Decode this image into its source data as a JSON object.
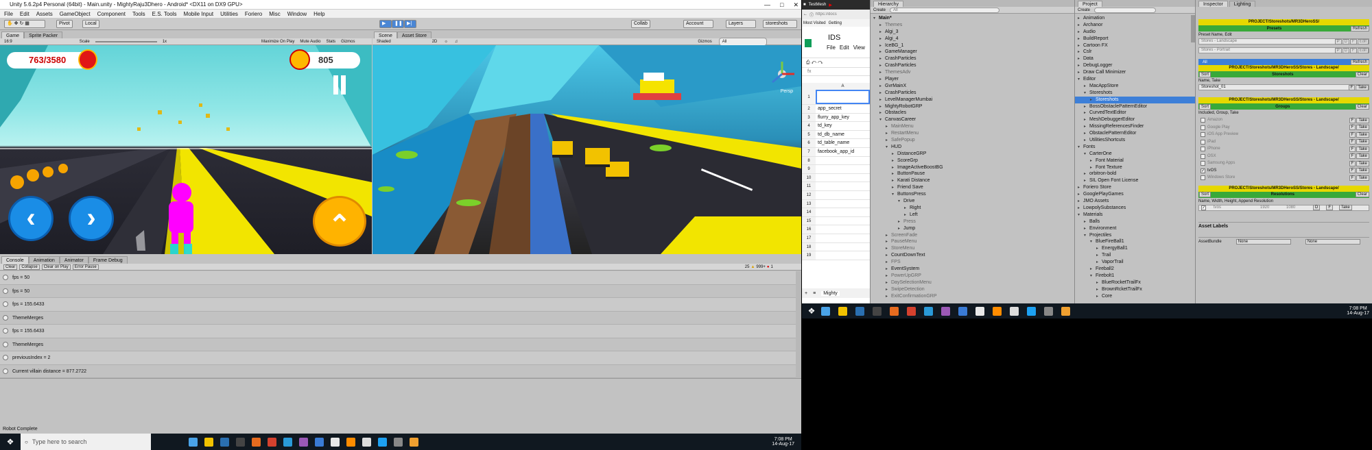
{
  "unity": {
    "title": "Unity 5.6.2p4 Personal (64bit) - Main.unity - MightyRaju3Dhero - Android* <DX11 on DX9 GPU>",
    "menu": [
      "File",
      "Edit",
      "Assets",
      "GameObject",
      "Component",
      "Tools",
      "E.S. Tools",
      "Mobile Input",
      "Utilities",
      "Foriero",
      "Misc",
      "Window",
      "Help"
    ],
    "toolbar": {
      "pivot": "Pivot",
      "local": "Local",
      "collab": "Collab",
      "account": "Account",
      "layers": "Layers",
      "layout": "storeshots"
    },
    "game_tabs": [
      "Game",
      "Sprite Packer"
    ],
    "game_bar": {
      "aspect": "16:9",
      "scale_label": "Scale",
      "scale_value": "1x",
      "maximize": "Maximize On Play",
      "mute": "Mute Audio",
      "stats": "Stats",
      "gizmos": "Gizmos"
    },
    "scene_tabs": [
      "Scene",
      "Asset Store"
    ],
    "scene_bar": {
      "shading": "Shaded",
      "mode": "2D",
      "gizmos": "Gizmos",
      "search": "All"
    },
    "hud": {
      "coins": "763/3580",
      "score": "805",
      "persp": "Persp"
    },
    "console_tabs": [
      "Console",
      "Animation",
      "Animator",
      "Frame Debug"
    ],
    "console_bar": {
      "clear": "Clear",
      "collapse": "Collapse",
      "clear_on_play": "Clear on Play",
      "error_pause": "Error Pause",
      "count_log": "25",
      "count_warn": "999+",
      "count_err": "1"
    },
    "logs": [
      "fps = 50",
      "fps = 50",
      "fps = 155.6433",
      "ThemeMerges",
      "fps = 155.6433",
      "ThemeMerges",
      "previousIndex = 2",
      "Current villain distance = 877.2722"
    ],
    "status": "Robot Complete"
  },
  "taskbar_left": {
    "search": "Type here to search",
    "time": "7:08 PM",
    "date": "14-Aug-17"
  },
  "taskbar_right": {
    "time": "7:08 PM",
    "date": "14-Aug-17"
  },
  "browser": {
    "tab1": "TestMesh",
    "url": "https://docs",
    "bookmark1": "Most Visited",
    "bookmark2": "Getting",
    "sheet_title": "IDS",
    "menu": [
      "File",
      "Edit",
      "View"
    ],
    "col": "A",
    "rows": [
      "1",
      "2",
      "3",
      "4",
      "5",
      "6",
      "7",
      "8",
      "9",
      "10",
      "11",
      "12",
      "13",
      "14",
      "15",
      "16",
      "17",
      "18",
      "19"
    ],
    "cells": [
      "",
      "app_secret",
      "flurry_app_key",
      "td_key",
      "td_db_name",
      "td_table_name",
      "facebook_app_id"
    ],
    "fx": "fx",
    "sheet_tab": "Mighty"
  },
  "hierarchy": {
    "title": "Hierarchy",
    "create": "Create",
    "search": "All",
    "items": [
      {
        "l": "Main*",
        "d": 0,
        "o": 1,
        "b": 1
      },
      {
        "l": "Themes",
        "d": 1,
        "g": 1
      },
      {
        "l": "Algi_3",
        "d": 1
      },
      {
        "l": "Algi_4",
        "d": 1
      },
      {
        "l": "IceBG_1",
        "d": 1
      },
      {
        "l": "GameManager",
        "d": 1
      },
      {
        "l": "CrashParticles",
        "d": 1
      },
      {
        "l": "CrashParticles",
        "d": 1
      },
      {
        "l": "ThemesAdv",
        "d": 1,
        "g": 1
      },
      {
        "l": "Player",
        "d": 1
      },
      {
        "l": "GvrMainX",
        "d": 1
      },
      {
        "l": "CrashParticles",
        "d": 1
      },
      {
        "l": "LevelManagerMumbai",
        "d": 1
      },
      {
        "l": "MightyRobotGRP",
        "d": 1
      },
      {
        "l": "Obstacles",
        "d": 1
      },
      {
        "l": "CanvasCareer",
        "d": 1,
        "o": 1
      },
      {
        "l": "MainMenu",
        "d": 2,
        "g": 1
      },
      {
        "l": "RestartMenu",
        "d": 2,
        "g": 1
      },
      {
        "l": "SafePopup",
        "d": 2,
        "g": 1
      },
      {
        "l": "HUD",
        "d": 2,
        "o": 1
      },
      {
        "l": "DistanceGRP",
        "d": 3
      },
      {
        "l": "ScoreGrp",
        "d": 3
      },
      {
        "l": "ImageActiveBoostBG",
        "d": 3
      },
      {
        "l": "ButtonPause",
        "d": 3
      },
      {
        "l": "Karati Distance",
        "d": 3
      },
      {
        "l": "Friend Save",
        "d": 3
      },
      {
        "l": "ButtonsPress",
        "d": 3,
        "o": 1
      },
      {
        "l": "Drive",
        "d": 4,
        "o": 1
      },
      {
        "l": "Right",
        "d": 5
      },
      {
        "l": "Left",
        "d": 5
      },
      {
        "l": "Press",
        "d": 4,
        "g": 1
      },
      {
        "l": "Jump",
        "d": 4
      },
      {
        "l": "ScreenFade",
        "d": 2,
        "g": 1
      },
      {
        "l": "PauseMenu",
        "d": 2,
        "g": 1
      },
      {
        "l": "StoreMenu",
        "d": 2,
        "g": 1
      },
      {
        "l": "CountDownText",
        "d": 2
      },
      {
        "l": "FPS",
        "d": 2,
        "g": 1
      },
      {
        "l": "EventSystem",
        "d": 2
      },
      {
        "l": "PowerUpGRP",
        "d": 2,
        "g": 1
      },
      {
        "l": "DaySelectionMenu",
        "d": 2,
        "g": 1
      },
      {
        "l": "SwipeDetection",
        "d": 2,
        "g": 1
      },
      {
        "l": "ExitConfirmationGRP",
        "d": 2,
        "g": 1
      }
    ]
  },
  "project": {
    "title": "Project",
    "create": "Create",
    "items": [
      {
        "l": "Animation",
        "d": 0
      },
      {
        "l": "Archanor",
        "d": 0
      },
      {
        "l": "Audio",
        "d": 0
      },
      {
        "l": "BuildReport",
        "d": 0
      },
      {
        "l": "Cartoon FX",
        "d": 0
      },
      {
        "l": "Cslr",
        "d": 0
      },
      {
        "l": "Data",
        "d": 0
      },
      {
        "l": "DebugLogger",
        "d": 0
      },
      {
        "l": "Draw Call Minimizer",
        "d": 0
      },
      {
        "l": "Editor",
        "d": 0,
        "o": 1
      },
      {
        "l": "MacAppStore",
        "d": 1
      },
      {
        "l": "Storeshots",
        "d": 1,
        "o": 1
      },
      {
        "l": "Storeshots",
        "d": 2,
        "s": 1
      },
      {
        "l": "BossObstaclePatternEditor",
        "d": 1
      },
      {
        "l": "CurvedTextEditor",
        "d": 1
      },
      {
        "l": "MeshDebuggerEditor",
        "d": 1
      },
      {
        "l": "MissingReferencesFinder",
        "d": 1
      },
      {
        "l": "ObstaclePatternEditor",
        "d": 1
      },
      {
        "l": "UtilitiesShortcuts",
        "d": 1
      },
      {
        "l": "Fonts",
        "d": 0,
        "o": 1
      },
      {
        "l": "CarterOne",
        "d": 1,
        "o": 1
      },
      {
        "l": "Font Material",
        "d": 2
      },
      {
        "l": "Font Texture",
        "d": 2
      },
      {
        "l": "orbitron-bold",
        "d": 1
      },
      {
        "l": "SIL Open Font License",
        "d": 1
      },
      {
        "l": "Foriero Store",
        "d": 0
      },
      {
        "l": "GooglePlayGames",
        "d": 0
      },
      {
        "l": "JMO Assets",
        "d": 0
      },
      {
        "l": "LowpolySubstances",
        "d": 0
      },
      {
        "l": "Materials",
        "d": 0,
        "o": 1
      },
      {
        "l": "Balls",
        "d": 1
      },
      {
        "l": "Environment",
        "d": 1
      },
      {
        "l": "Projectiles",
        "d": 1,
        "o": 1
      },
      {
        "l": "BlueFireBall1",
        "d": 2,
        "o": 1
      },
      {
        "l": "EnergyBall1",
        "d": 3
      },
      {
        "l": "Trail",
        "d": 3
      },
      {
        "l": "VaporTrail",
        "d": 3
      },
      {
        "l": "Fireball2",
        "d": 2
      },
      {
        "l": "Firebolt1",
        "d": 2,
        "o": 1
      },
      {
        "l": "BlueRocketTrailFx",
        "d": 3
      },
      {
        "l": "BrownRcketTrailFx",
        "d": 3
      },
      {
        "l": "Core",
        "d": 3
      }
    ]
  },
  "inspector": {
    "tab1": "Inspector",
    "tab2": "Lighting",
    "path1": "PROJECT/Storeshots/MR3DHeroSS/",
    "presets": "Presets",
    "refresh": "Refresh",
    "preset_caption": "Preset Name, Edit",
    "preset1": "Stores - Landscape",
    "preset2": "Stores - Portrait",
    "all": "All",
    "path2": "PROJECT/Storeshots/MR3DHeroSS/Stores - Landscape/",
    "sort": "Sort",
    "storeshots": "Storeshots",
    "clear": "Clear",
    "name_take": "Name, Take",
    "shot_name": "Storeshot_01",
    "groups": "Groups",
    "group_caption": "Included, Group, Take",
    "groups_list": [
      "Amazon",
      "Google Play",
      "iOS App Preview",
      "iPad",
      "iPhone",
      "OSX",
      "Samsung Apps",
      "tvOS",
      "Windows Store"
    ],
    "resolutions": "Resolutions",
    "res_caption": "Name, Width, Height, Append Resolution",
    "res_name": "tvos",
    "res_w": "1920",
    "res_h": "1080",
    "asset_labels": "Asset Labels",
    "asset_bundle": "AssetBundle",
    "none": "None"
  }
}
